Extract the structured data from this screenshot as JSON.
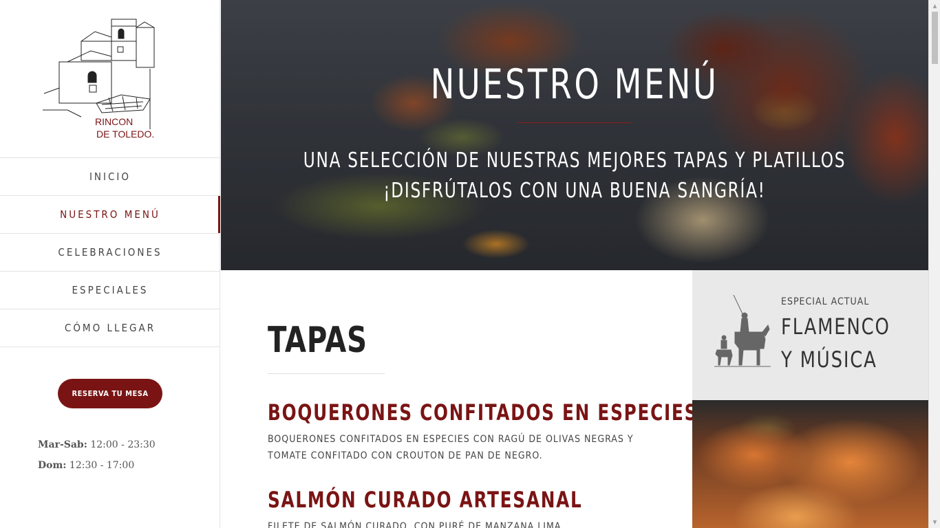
{
  "brand": {
    "logo_text_line1": "RINCON",
    "logo_text_line2": "DE TOLEDO."
  },
  "nav": [
    {
      "label": "INICIO",
      "active": false
    },
    {
      "label": "NUESTRO MENÚ",
      "active": true
    },
    {
      "label": "CELEBRACIONES",
      "active": false
    },
    {
      "label": "ESPECIALES",
      "active": false
    },
    {
      "label": "CÓMO LLEGAR",
      "active": false
    }
  ],
  "reserve_button": "RESERVA TU MESA",
  "hours": [
    {
      "days": "Mar-Sab:",
      "time": "12:00 - 23:30"
    },
    {
      "days": "Dom:",
      "time": "12:30 - 17:00"
    }
  ],
  "hero": {
    "title": "NUESTRO MENÚ",
    "subtitle_line1": "UNA SELECCIÓN DE NUESTRAS MEJORES TAPAS Y PLATILLOS",
    "subtitle_line2": "¡DISFRÚTALOS CON UNA BUENA SANGRÍA!"
  },
  "section": {
    "title": "TAPAS"
  },
  "dishes": [
    {
      "name": "BOQUERONES CONFITADOS EN ESPECIES",
      "description": "BOQUERONES CONFITADOS EN ESPECIES CON RAGÚ DE OLIVAS NEGRAS Y TOMATE CONFITADO CON CROUTON DE PAN DE NEGRO."
    },
    {
      "name": "SALMÓN CURADO ARTESANAL",
      "description": "FILETE DE SALMÓN CURADO, CON PURÉ DE MANZANA LIMA"
    }
  ],
  "special": {
    "label": "ESPECIAL ACTUAL",
    "title": "FLAMENCO Y MÚSICA"
  },
  "colors": {
    "accent": "#7a1414",
    "sidebar_border": "#e2e2e2",
    "special_bg": "#e9e9e9"
  }
}
